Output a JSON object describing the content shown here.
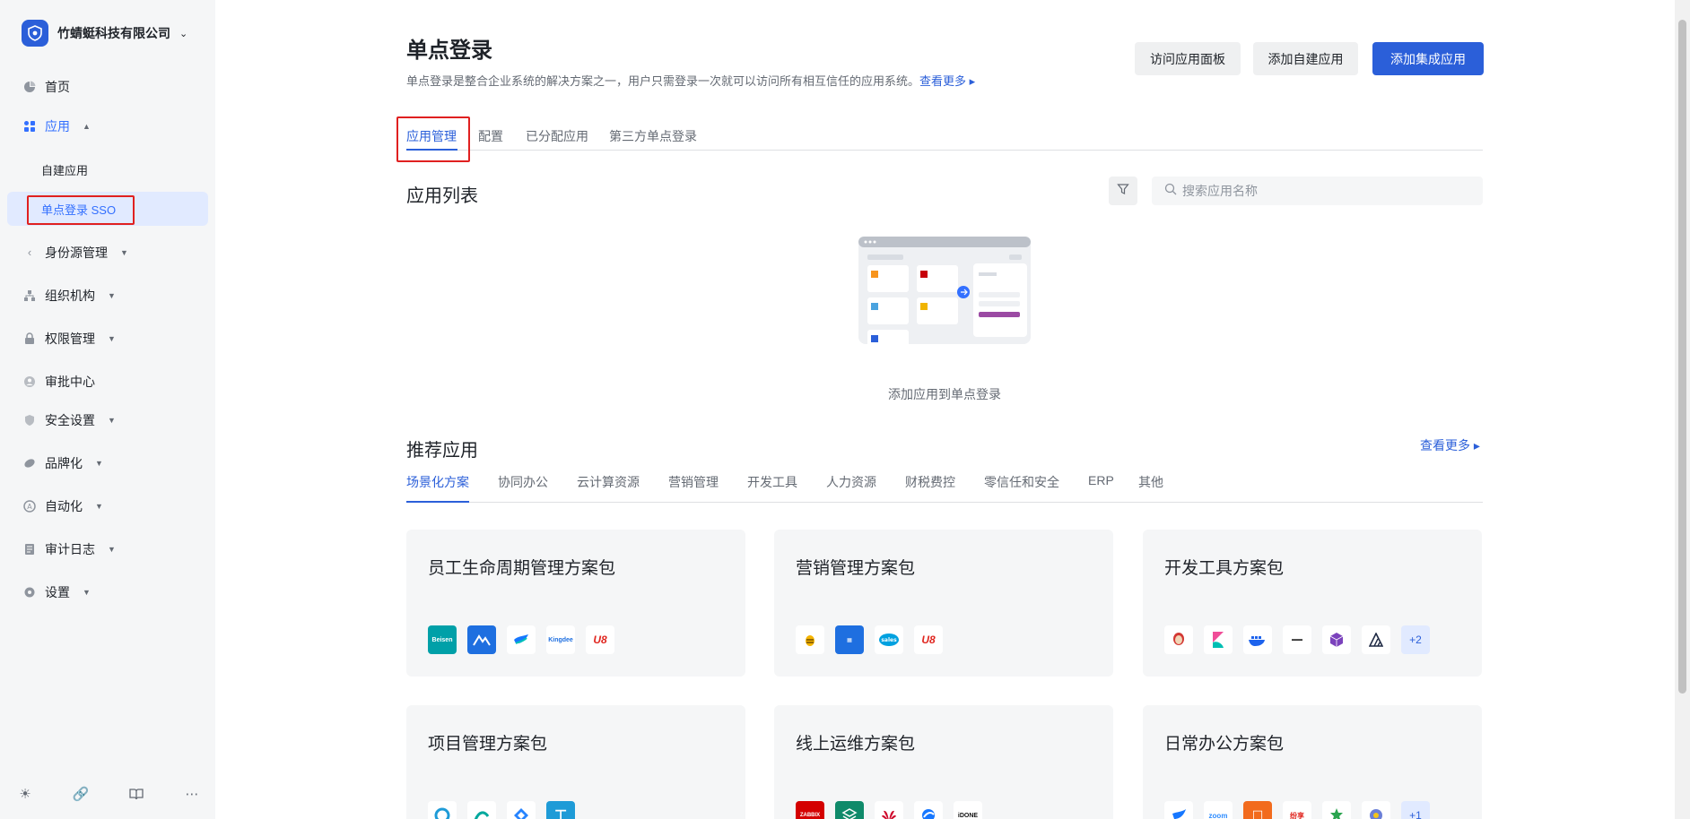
{
  "org": {
    "name": "竹蜻蜓科技有限公司"
  },
  "sidebar": {
    "items": [
      {
        "label": "首页",
        "icon": "pie-chart-icon"
      },
      {
        "label": "应用",
        "icon": "apps-icon"
      },
      {
        "label": "身份源管理",
        "icon": "share-icon"
      },
      {
        "label": "组织机构",
        "icon": "org-tree-icon"
      },
      {
        "label": "权限管理",
        "icon": "lock-icon"
      },
      {
        "label": "审批中心",
        "icon": "user-circle-icon"
      },
      {
        "label": "安全设置",
        "icon": "shield-icon"
      },
      {
        "label": "品牌化",
        "icon": "brush-icon"
      },
      {
        "label": "自动化",
        "icon": "robot-icon"
      },
      {
        "label": "审计日志",
        "icon": "document-icon"
      },
      {
        "label": "设置",
        "icon": "gear-icon"
      }
    ],
    "sub": [
      {
        "label": "自建应用"
      },
      {
        "label": "单点登录 SSO"
      }
    ]
  },
  "header": {
    "title": "单点登录",
    "desc": "单点登录是整合企业系统的解决方案之一，用户只需登录一次就可以访问所有相互信任的应用系统。",
    "more": "查看更多",
    "btn_panel": "访问应用面板",
    "btn_self": "添加自建应用",
    "btn_integrated": "添加集成应用"
  },
  "tabs": [
    "应用管理",
    "配置",
    "已分配应用",
    "第三方单点登录"
  ],
  "app_list": {
    "title": "应用列表",
    "search_placeholder": "搜索应用名称",
    "empty": "添加应用到单点登录"
  },
  "recommend": {
    "title": "推荐应用",
    "more": "查看更多",
    "categories": [
      "场景化方案",
      "协同办公",
      "云计算资源",
      "营销管理",
      "开发工具",
      "人力资源",
      "财税费控",
      "零信任和安全",
      "ERP",
      "其他"
    ],
    "cards": [
      {
        "title": "员工生命周期管理方案包",
        "more": ""
      },
      {
        "title": "营销管理方案包",
        "more": ""
      },
      {
        "title": "开发工具方案包",
        "more": "+2"
      },
      {
        "title": "项目管理方案包",
        "more": ""
      },
      {
        "title": "线上运维方案包",
        "more": ""
      },
      {
        "title": "日常办公方案包",
        "more": "+1"
      }
    ],
    "icon_labels": {
      "beisen": "Beisen",
      "kingdee": "Kingdee",
      "u8": "U8",
      "salesforce": "sales",
      "zabbix": "ZABBIX",
      "zoom": "zoom",
      "idone": "iDONE",
      "fenxiang": "纷享"
    }
  },
  "colors": {
    "accent": "#2b5fd9",
    "highlight": "#e02020",
    "sidebar_bg": "#f5f6f7"
  }
}
